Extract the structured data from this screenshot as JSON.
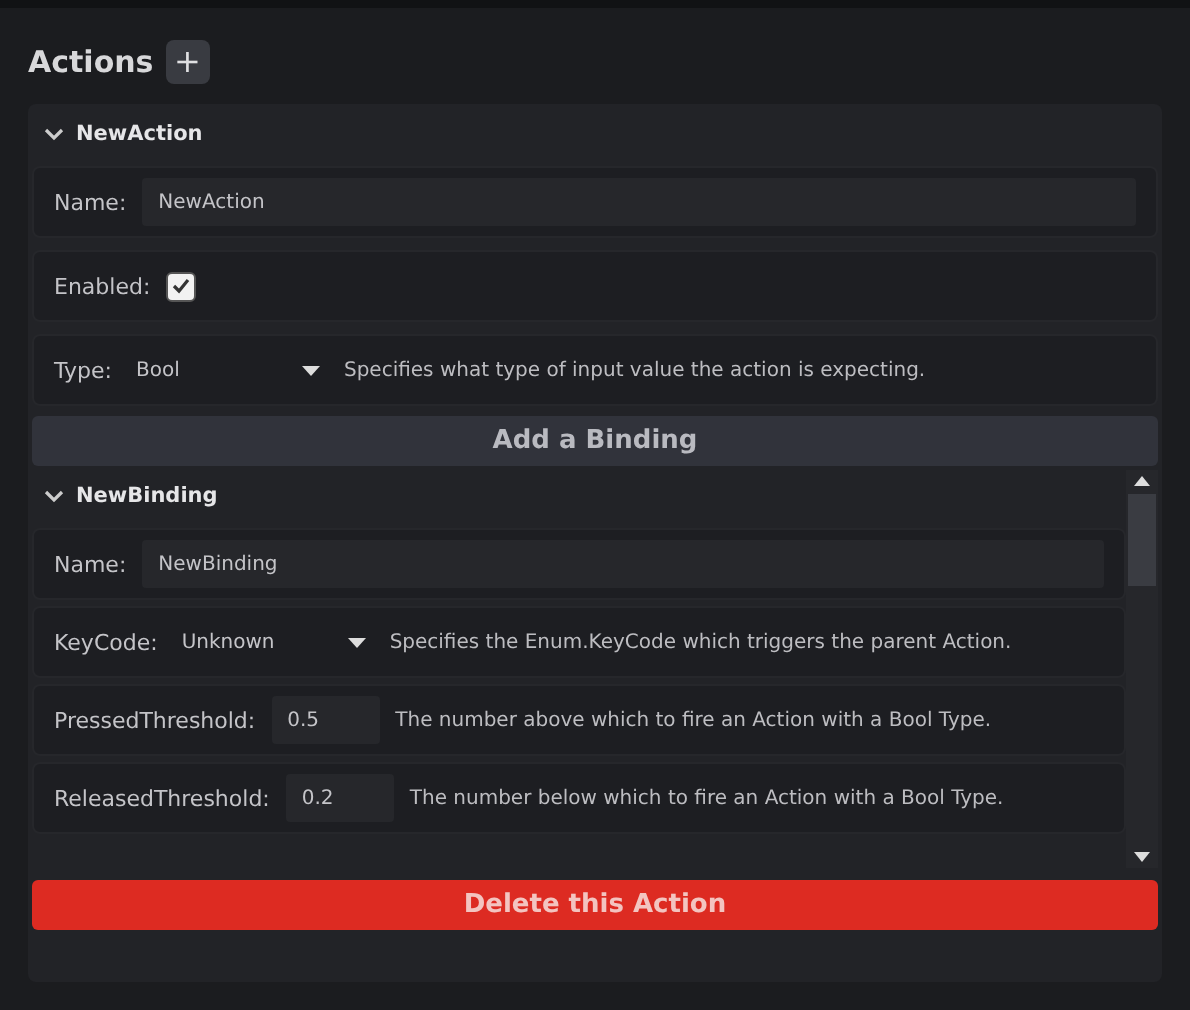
{
  "title": "Actions",
  "add_button": "+",
  "action": {
    "name": "NewAction",
    "expanded": true,
    "fields": [
      {
        "kind": "text",
        "label": "Name:",
        "value": "NewAction"
      },
      {
        "kind": "checkbox",
        "label": "Enabled:",
        "checked": true
      },
      {
        "kind": "dropdown",
        "label": "Type:",
        "value": "Bool",
        "description": "Specifies what type of input value the action is expecting."
      }
    ]
  },
  "add_binding": "Add a Binding",
  "binding": {
    "name": "NewBinding",
    "expanded": true,
    "fields": [
      {
        "kind": "text",
        "label": "Name:",
        "value": "NewBinding"
      },
      {
        "kind": "dropdown",
        "label": "KeyCode:",
        "value": "Unknown",
        "description": "Specifies the Enum.KeyCode which triggers the parent Action."
      },
      {
        "kind": "number",
        "label": "PressedThreshold:",
        "value": "0.5",
        "description": "The number above which to fire an Action with a Bool Type."
      },
      {
        "kind": "number",
        "label": "ReleasedThreshold:",
        "value": "0.2",
        "description": "The number below which to fire an Action with a Bool Type."
      }
    ]
  },
  "delete_button": "Delete this Action"
}
